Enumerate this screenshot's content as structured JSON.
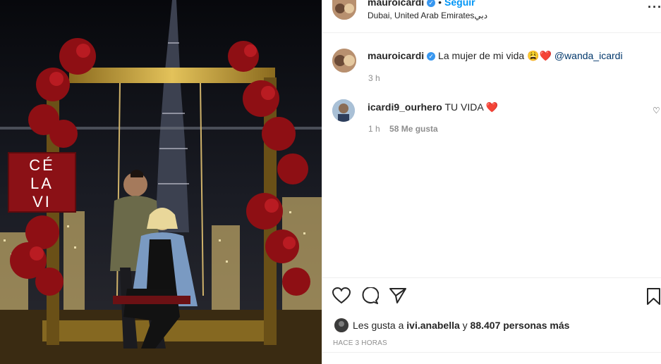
{
  "post": {
    "author": "mauroicardi",
    "follow_label": "Seguir",
    "separator": "•",
    "location": "Dubai, United Arab Emiratesدبي",
    "photo_sign_text": "CÉ LA VI"
  },
  "caption": {
    "username": "mauroicardi",
    "text": "La mujer de mi vida 😩❤️",
    "mention": "@wanda_icardi",
    "time": "3 h"
  },
  "comment": {
    "username": "icardi9_ourhero",
    "text": "TU VIDA ❤️",
    "time": "1 h",
    "likes": "58 Me gusta"
  },
  "likes": {
    "prefix": "Les gusta a",
    "user": "ivi.anabella",
    "middle": "y",
    "count": "88.407 personas más"
  },
  "timestamp": "HACE 3 HORAS",
  "colors": {
    "accent": "#0095f6",
    "verified": "#3897f0",
    "mention": "#00376b",
    "heart": "#ed4956"
  }
}
